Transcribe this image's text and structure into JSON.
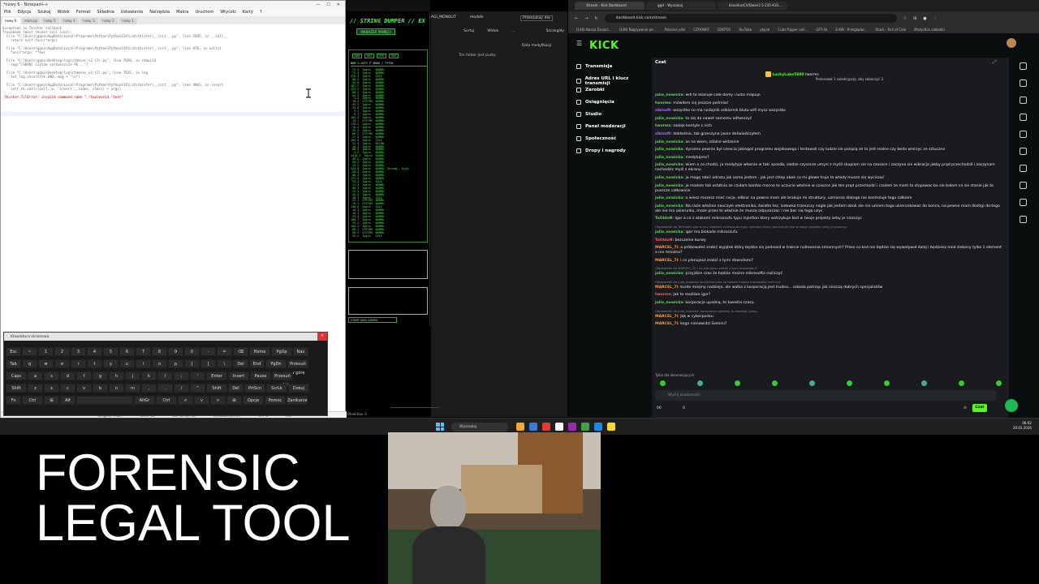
{
  "notepad": {
    "title": "*nowy 6 - Notepad++",
    "menu": [
      "Plik",
      "Edycja",
      "Szukaj",
      "Widok",
      "Format",
      "Składnia",
      "Ustawienia",
      "Narzędzia",
      "Makra",
      "Uruchom",
      "Wtyczki",
      "Karty",
      "?"
    ],
    "tabs": [
      "nowy 6",
      "main.py",
      "nowy 5",
      "nowy 4",
      "nowy 3",
      "nowy 2",
      "nowy 1"
    ],
    "lines": [
      "Exception in Tkinter callback",
      "Traceback (most recent call last):",
      "  File \"C:\\Users\\ggna\\AppData\\Local\\Programs\\Python\\Python314\\Lib\\tkinter\\__init__.py\", line 2085, in __call__",
      "    return self.func(*args)",
      "",
      "  File \"C:\\Users\\ggna\\AppData\\Local\\Programs\\Python\\Python314\\Lib\\tkinter\\__init__.py\", line 876, in callit",
      "    func(*args, **kw)",
      "",
      "  File \"C:\\Users\\ggna\\Desktop\\logistamiec_v3 (2).py\", line 7050, in rebuild",
      "    log(\"[SKAN] Czytam najświeższe PE...\")",
      "",
      "  File \"C:\\Users\\ggna\\Desktop\\logistamiec_v3 (2).py\", line 7035, in log",
      "    txt_log.insert(tk.END, msg + \"\\n\")",
      "",
      "  File \"C:\\Users\\ggna\\AppData\\Local\\Programs\\Python\\Python314\\Lib\\tkinter\\__init__.py\", line 4001, in insert",
      "    self.tk.call((self._w, 'insert', index, chars) + args)",
      "",
      "_tkinter.TclError: invalid command name \".!toplevel4.!text\""
    ],
    "status": [
      "Długość: 1 227",
      "Linie: 18",
      "Lin: 18  Kol: 56",
      "Windows (CR LF)",
      "UTF-8",
      "INS"
    ]
  },
  "keyboard": {
    "title": "Klawiatura ekranowa",
    "row1": [
      "Esc",
      "~",
      "1",
      "2",
      "3",
      "4",
      "5",
      "6",
      "7",
      "8",
      "9",
      "0",
      "-",
      "=",
      "⌫",
      "Home",
      "PgUp",
      "Nav"
    ],
    "row2": [
      "Tab",
      "q",
      "w",
      "e",
      "r",
      "t",
      "y",
      "u",
      "i",
      "o",
      "p",
      "[",
      "]",
      "\\",
      "Del",
      "End",
      "PgDn",
      "Przesuń w górę"
    ],
    "row3": [
      "Caps",
      "a",
      "s",
      "d",
      "f",
      "g",
      "h",
      "j",
      "k",
      "l",
      ";",
      "'",
      "Enter",
      "Insert",
      "Pause",
      "Przesuń w dół"
    ],
    "row4": [
      "Shift",
      "z",
      "x",
      "c",
      "v",
      "b",
      "n",
      "m",
      ",",
      ".",
      "/",
      "^",
      "Shift",
      "Del",
      "PrtScn",
      "ScrLk",
      "Dokuj"
    ],
    "row5": [
      "Fn",
      "Ctrl",
      "⊞",
      "Alt",
      "",
      "AltGr",
      "Ctrl",
      "<",
      "v",
      ">",
      "⊞",
      "Opcje",
      "Pomoc",
      "Zanikanie"
    ]
  },
  "pyapp": {
    "header": "// STRING DUMPER // EX",
    "manager_btn": "MANAŻER PAMIĘCI",
    "toolbar": [
      "BAR",
      "HAT",
      "LOG",
      "RAZ"
    ],
    "columns": "BAM  % UŻYT  P  OKNO / TYTUŁ",
    "rows": [
      " 75.4  Iggra   NORMA",
      " 72.3  Iggra   NORMA",
      "476.3  Iggra   IDLE",
      " 88.2  Iggra   NORMA",
      " 34.8  Iggra   NORMA",
      "187.7  Iggra   NORMA",
      "123.3  Iggra   NORMA",
      " 88.2  Iggra   NORMA",
      " 64.3  Iggra   NORMA",
      "  5.3  Iggra   NORMA",
      " 18.3  SYSTEM  NORMA",
      " 45.3  Iggra   NORMA",
      " 33.8  Iggra   NORMA",
      "  9.3  Iggra   NORMA",
      "  8.7  Iggra   NORMA",
      "104.3  Iggra   NORMA",
      " 16.7  SYSTEM  NORMA",
      "178.2  Iggra   NORMA",
      " 18.4  Iggra   NORMA",
      " 35.3  Iggra   NORMA",
      " 66.2  SYSTEM  NORMA",
      " 27.3  Iggra   NORMA",
      "109.3  Iggra   IDLE",
      " 32.4  Iggra   BELOW",
      " 16.2  Iggra   NORMA",
      " 88.3  Iggra   NORMA",
      "  4.5  Iggra   NORMA",
      "4410.2  Iggra  NORMA",
      " 46.2  Iggra   NORMA",
      " 56.3  Iggra   NORMA",
      " 19.3  Iggra   NORMA",
      "434.8  Iggra   NORMA  Stream - Kick",
      " 28.3  Iggra   NORMA",
      " 46.3  Iggra   NORMA",
      "177.4  Iggra   NORMA",
      " 53.4  Iggra   IDLE",
      " 11.3  Iggra   NORMA",
      " 66.3  Iggra   NORMA",
      " 15.3  Iggra   NORMA",
      " 45.3  Iggra   NORMA",
      " 38.3  Iggra   IDLE",
      " 23.1  SYSTEM  NORMA",
      " 76.3  SYSTEM  NORMA",
      "130.6  Iggra   IDLE",
      " 18.3  Iggra   NORMA",
      " 18.3  Iggra   NORMA",
      " 53.4  Iggra   NORMA",
      "108.7  Iggra   NORMA",
      " 94.2  Iggra   NORMA",
      "104.3  Iggra   NORMA",
      " 68.1  SYSTEM  NORMA",
      " 58.3  SYSTEM  NORMA",
      " 35.2  Iggra   IDLE"
    ],
    "bottom_btn": "START JAKO ADMIN"
  },
  "middle": {
    "tabs": [
      "AGI_MONOLIT",
      "models",
      "Przeszukaj: mo"
    ],
    "toolbar": [
      "Sortuj",
      "Widok",
      "...",
      "Szczegóły"
    ],
    "col_header": "Data modyfikacji",
    "empty": "Ten folder jest pusty.",
    "status": "Obiektów: 0"
  },
  "browser": {
    "tabs": [
      "Stream - Kick Dashboard",
      "ggsl - Wyszukaj",
      "klaudius/CV/Qwen2.5-235-A10...."
    ],
    "url": "dashboard.kick.com/stream",
    "bookmarks": [
      "(148) Nasza Zasiad...",
      "(148) Nagrywanie pe...",
      "Pobrane pliki",
      "CZOONIO",
      "CENTOS",
      "YouTube",
      "płyjad",
      "Cube Ripper onli...",
      "GPT-4o",
      "E-KW - Przeglądar...",
      "Stack - Roll of Cole",
      "Wszystkie zakładki"
    ],
    "logo": "KICK",
    "side": [
      "Transmisja",
      "Adres URL i klucz transmisji",
      "Zarobki",
      "Osiągnięcia",
      "Studio",
      "Panel moderacji",
      "Społeczność",
      "Dropy i nagrody"
    ],
    "chat_title": "Czat",
    "pinned_user": "LuckyLuke5880",
    "pinned_sub": "tworms",
    "pinned_text": "Podarował 1 subskrypcję, aby zobaczyć 3.",
    "messages": [
      {
        "u": "julia_nowicka",
        "c": "#5cd65c",
        "t": "wifi to skanuje całe domy i ludzi mapuje"
      },
      {
        "u": "tworms",
        "c": "#5cd65c",
        "t": "mówiłem się jeszcze pośmiać"
      },
      {
        "u": "zibisoft",
        "c": "#a970ff",
        "t": "wszystko co ma nadajnik odbiornik blutu wifi mysz wszystko"
      },
      {
        "u": "julia_nowicka",
        "c": "#5cd65c",
        "t": "to się da nawet samemu odtworzyć"
      },
      {
        "u": "tworms",
        "c": "#5cd65c",
        "t": "zasięk kontyle z nich"
      },
      {
        "u": "zibisoft",
        "c": "#a970ff",
        "t": "dokładnie, tak grzeszyna jasne doświadczyłem"
      },
      {
        "u": "julia_nowicka",
        "c": "#5cd65c",
        "t": "as no wiem, zdalne widzenie"
      },
      {
        "u": "julia_nowicka",
        "c": "#5cd65c",
        "t": "dynamo pewnie był czescia jakiegoś programu wojskowego i testowali czy ludzie sie poispią ze to jest realne czy beda wierzyc ze sztuczne"
      },
      {
        "u": "julia_nowicka",
        "c": "#5cd65c",
        "t": "medytujesz?"
      },
      {
        "u": "julia_nowicka",
        "c": "#5cd65c",
        "t": "wiem o co chodzi, ja medytuje własnie w taki sposób, siedze czyszcze umysl z myśli skupiam sie na czaszce i zaczyna sie wibracja jakby prąd przechodził i zaczynam nachodzic myśl z ekranu"
      },
      {
        "u": "julia_nowicka",
        "c": "#5cd65c",
        "t": "ja mogę robić odrazu jak sama jestem - jak jest chłop obok co mi głowe truje to wtedy musze się wyciszać"
      },
      {
        "u": "julia_nowicka",
        "c": "#5cd65c",
        "t": "ja miałam tak ostatnio ze czułam bardzo mocno te uczucie właśnie w czaszce jak ten prąd przechodzi i czułam ze mam to stopowac bo sie bałam co sie stanie jak to puszcze całkowicie"
      },
      {
        "u": "julia_nowicka",
        "c": "#5cd65c",
        "t": "a wiesz mozesz mieć racje, odbior na pewno mam ale brakuje mi struktury, uzmienia dlatego nie kontroluje tego całkiem"
      },
      {
        "u": "julia_nowicka",
        "c": "#5cd65c",
        "t": "Na razie właśnie nauczyłe elektronika, światło tez, lodowka trzeszczy nagle jak jestem obok ale nie umiem tego ukierunkowac do konca, na pewno mam dostęp do tego ale nie ma ukierunku, moze przez to właśnie że muszę odpuszczac i nie bac się tego uzyc"
      },
      {
        "u": "ToOldoN",
        "c": "#5cd65c",
        "t": "Igor a co z atakami mikroszufu typu injection ktory wstrzykuje kod w twoje projekty zeby je niszczyc"
      },
      {
        "note": "Odpowiedź do ToOldoN: Igor a co z atakami mikroszufu typu injection ktory wstrzykuje kod w twoje projekty zeby je niszczyc"
      },
      {
        "u": "julia_nowicka",
        "c": "#5cd65c",
        "t": "igor ma blokade mikroszufu"
      },
      {
        "u": "ToOldoN",
        "c": "#ff5b5b",
        "t": "bezczelne kurwy"
      },
      {
        "u": "MARCEL_7i",
        "c": "#ff9a3c",
        "t": "a próbowałeś zrobić wyjątek który będzie się podnosił w trakcie nullowania zmiennych? Przez co kod nie będzie się wywoływał dalej i będziesz miał zlebany tylko 1 element a nie mnożna?"
      },
      {
        "u": "MARCEL_7i",
        "c": "#ff9a3c",
        "t": "i co planujesz zrobić z tymi dowodami?"
      },
      {
        "note": "Odpowiedź do MARCEL_7i: i co planujesz zrobić z tymi dowodami?"
      },
      {
        "u": "julia_nowicka",
        "c": "#5cd65c",
        "t": "przyjdzie czas że będzie można mikrosofta rozliczyć"
      },
      {
        "note": "Odpowiedź do julia_nowicka: przyjdzie czas ze bedzie mozna mikrosofta rozliczyć"
      },
      {
        "u": "MARCEL_7i",
        "c": "#ff9a3c",
        "t": "kurde miejmy nadzieje, ale walka z korporacją jest trudna... szkoda patrząc jak niszczą dobrych specjalistów"
      },
      {
        "u": "tworms",
        "c": "#ff5b5b",
        "t": "jak to możliwe igor?"
      },
      {
        "u": "julia_nowicka",
        "c": "#5cd65c",
        "t": "korporacje upadną, to kwestia czasu."
      },
      {
        "note": "Odpowiedź do julia_nowicka: korporacje upadną, to kwestia czasu."
      },
      {
        "u": "MARCEL_7i",
        "c": "#ff9a3c",
        "t": "Jak w cyberpunku"
      },
      {
        "u": "MARCEL_7i",
        "c": "#ff9a3c",
        "t": "kogo nienawidzi Gemini?"
      }
    ],
    "subs_only": "Tylko dla obserwujących",
    "input_placeholder": "Wyślij wiadomość",
    "counter1": "00",
    "counter2": "0",
    "send": "Czat"
  },
  "taskbar": {
    "search": "Wyszukaj",
    "time": "06:02",
    "date": "20.03.2026"
  },
  "overlay": {
    "line1": "FORENSIC",
    "line2": "LEGAL TOOL"
  }
}
